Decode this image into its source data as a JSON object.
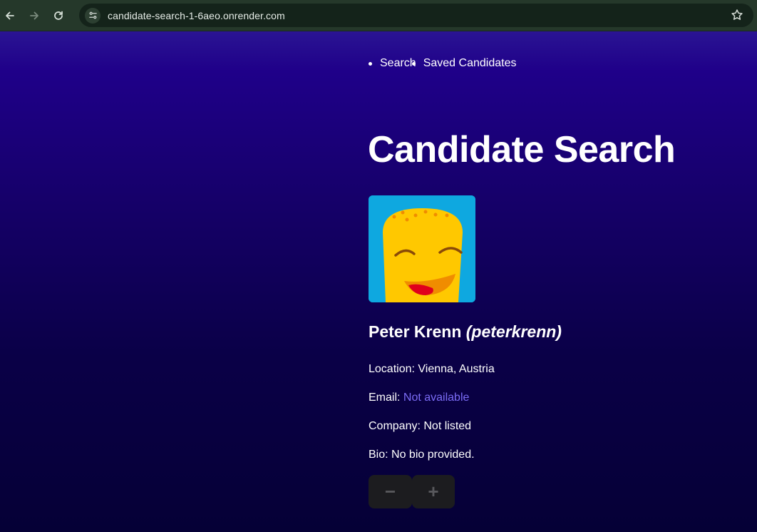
{
  "browser": {
    "url": "candidate-search-1-6aeo.onrender.com",
    "icons": [
      "back-arrow-icon",
      "forward-arrow-icon",
      "reload-icon",
      "site-info-icon",
      "bookmark-star-icon"
    ]
  },
  "nav": {
    "items": [
      {
        "label": "Search"
      },
      {
        "label": "Saved Candidates"
      }
    ]
  },
  "page": {
    "title": "Candidate Search"
  },
  "candidate": {
    "name": "Peter Krenn",
    "login": "(peterkrenn)",
    "location_label": "Location: ",
    "location": "Vienna, Austria",
    "email_label": "Email: ",
    "email": "Not available",
    "company_label": "Company: ",
    "company": "Not listed",
    "bio_label": "Bio: ",
    "bio": "No bio provided."
  },
  "actions": {
    "reject_label": "−",
    "accept_label": "+"
  },
  "colors": {
    "page_gradient_top": "#1f0089",
    "page_gradient_bottom": "#050036",
    "link": "#7b6cf6",
    "button_bg": "#1c1c1f",
    "avatar_bg": "#0ea8e0",
    "avatar_face": "#ffc800"
  }
}
